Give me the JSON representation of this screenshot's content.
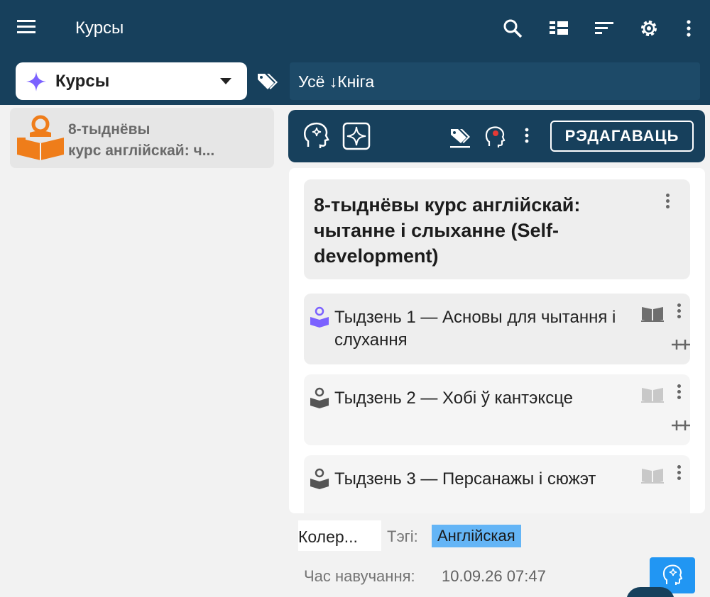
{
  "appbar": {
    "title": "Курсы",
    "icons": [
      "menu-icon",
      "search-icon",
      "view-list-icon",
      "sort-icon",
      "gear-icon",
      "more-vert-icon"
    ]
  },
  "selector": {
    "label": "Курсы",
    "icon": "sparkle-icon"
  },
  "filter": {
    "text": "Усё ↓Кніга"
  },
  "left_list": {
    "items": [
      {
        "title": "8-тыднёвы\nкурс англійскай: ч..."
      }
    ]
  },
  "toolbar": {
    "edit_label": "РЭДАГАВАЦЬ"
  },
  "course": {
    "title": "8-тыднёвы курс англійскай: чытанне і слыханне (Self-development)"
  },
  "weeks": [
    {
      "title": "Тыдзень 1 — Асновы для чытання і слухання"
    },
    {
      "title": "Тыдзень 2 — Хобі ў кантэксце"
    },
    {
      "title": "Тыдзень 3 — Персанажы і сюжэт"
    }
  ],
  "meta": {
    "colors_label": "Колер...",
    "tags_label": "Тэгі:",
    "tag": "Англійская",
    "study_label": "Час навучання:",
    "study_value": "10.09.26 07:47"
  },
  "colors": {
    "primary": "#17405c",
    "accent_orange": "#ef7d1a",
    "accent_purple": "#7b61ff",
    "tag_blue": "#64b5f6",
    "fab_blue": "#2196f3"
  }
}
